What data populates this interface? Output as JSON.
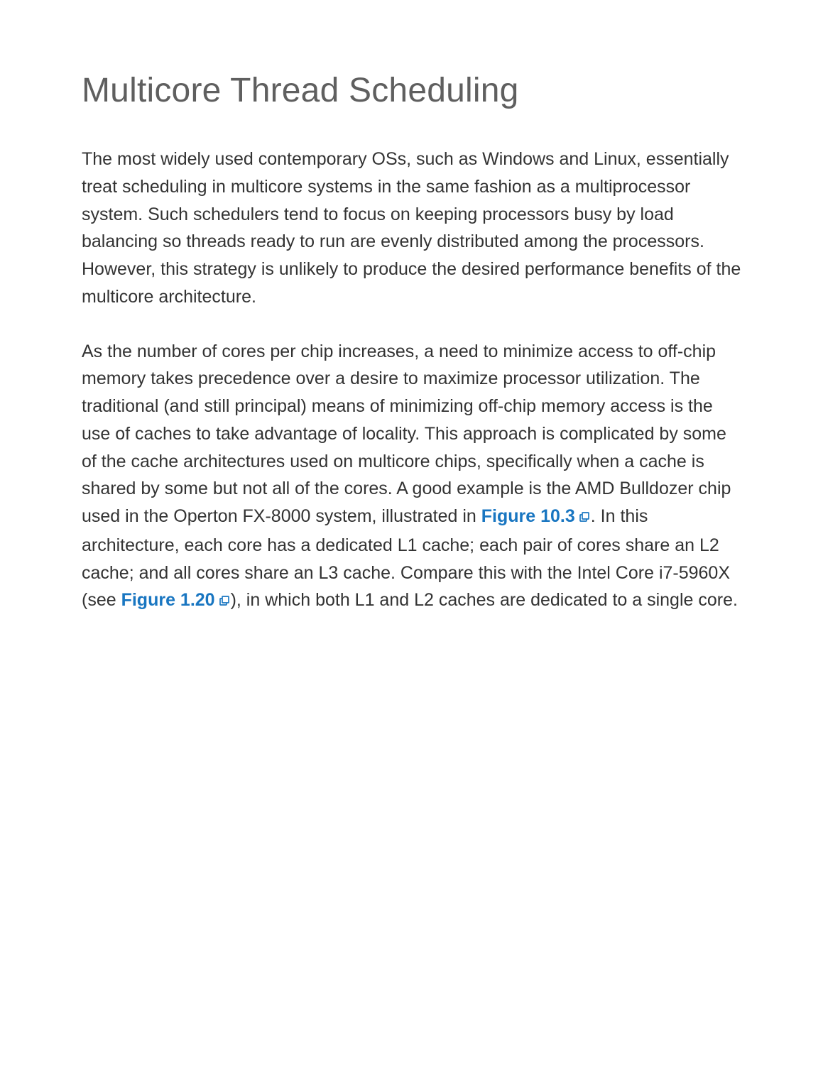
{
  "heading": "Multicore Thread Scheduling",
  "paragraph1": "The most widely used contemporary OSs, such as Windows and Linux, essentially treat scheduling in multicore systems in the same fashion as a multiprocessor system. Such schedulers tend to focus on keeping processors busy by load balancing so threads ready to run are evenly distributed among the processors. However, this strategy is unlikely to produce the desired performance benefits of the multicore architecture.",
  "paragraph2": {
    "part1": "As the number of cores per chip increases, a need to minimize access to off-chip memory takes precedence over a desire to maximize processor utilization. The traditional (and still principal) means of minimizing off-chip memory access is the use of caches to take advantage of locality. This approach is complicated by some of the cache architectures used on multicore chips, specifically when a cache is shared by some but not all of the cores. A good example is the AMD Bulldozer chip used in the Operton FX-8000 system, illustrated in ",
    "link1_text": "Figure 10.3",
    "part2": ". In this architecture, each core has a dedicated L1 cache; each pair of cores share an L2 cache; and all cores share an L3 cache. Compare this with the Intel Core i7-5960X (see ",
    "link2_text": "Figure 1.20",
    "part3": "), in which both L1 and L2 caches are dedicated to a single core."
  },
  "link_color": "#1976c1"
}
